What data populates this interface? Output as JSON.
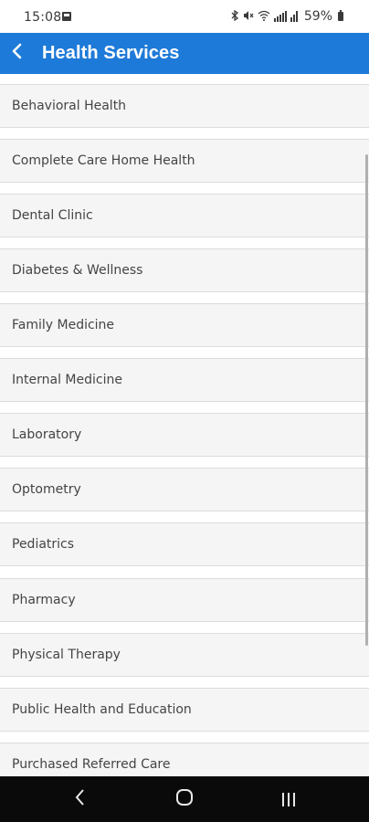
{
  "status_bar": {
    "time": "15:08",
    "battery": "59%",
    "icons": [
      "gallery-icon",
      "bluetooth-icon",
      "mute-icon",
      "wifi-icon",
      "signal-icon",
      "battery-icon"
    ]
  },
  "app_bar": {
    "title": "Health Services",
    "background": "#1e7ad8"
  },
  "services": [
    "Behavioral Health",
    "Complete Care Home Health",
    "Dental Clinic",
    "Diabetes & Wellness",
    "Family Medicine",
    "Internal Medicine",
    "Laboratory",
    "Optometry",
    "Pediatrics",
    "Pharmacy",
    "Physical Therapy",
    "Public Health and Education",
    "Purchased Referred Care"
  ],
  "nav_bar": {
    "buttons": [
      "back",
      "home",
      "recents"
    ]
  }
}
